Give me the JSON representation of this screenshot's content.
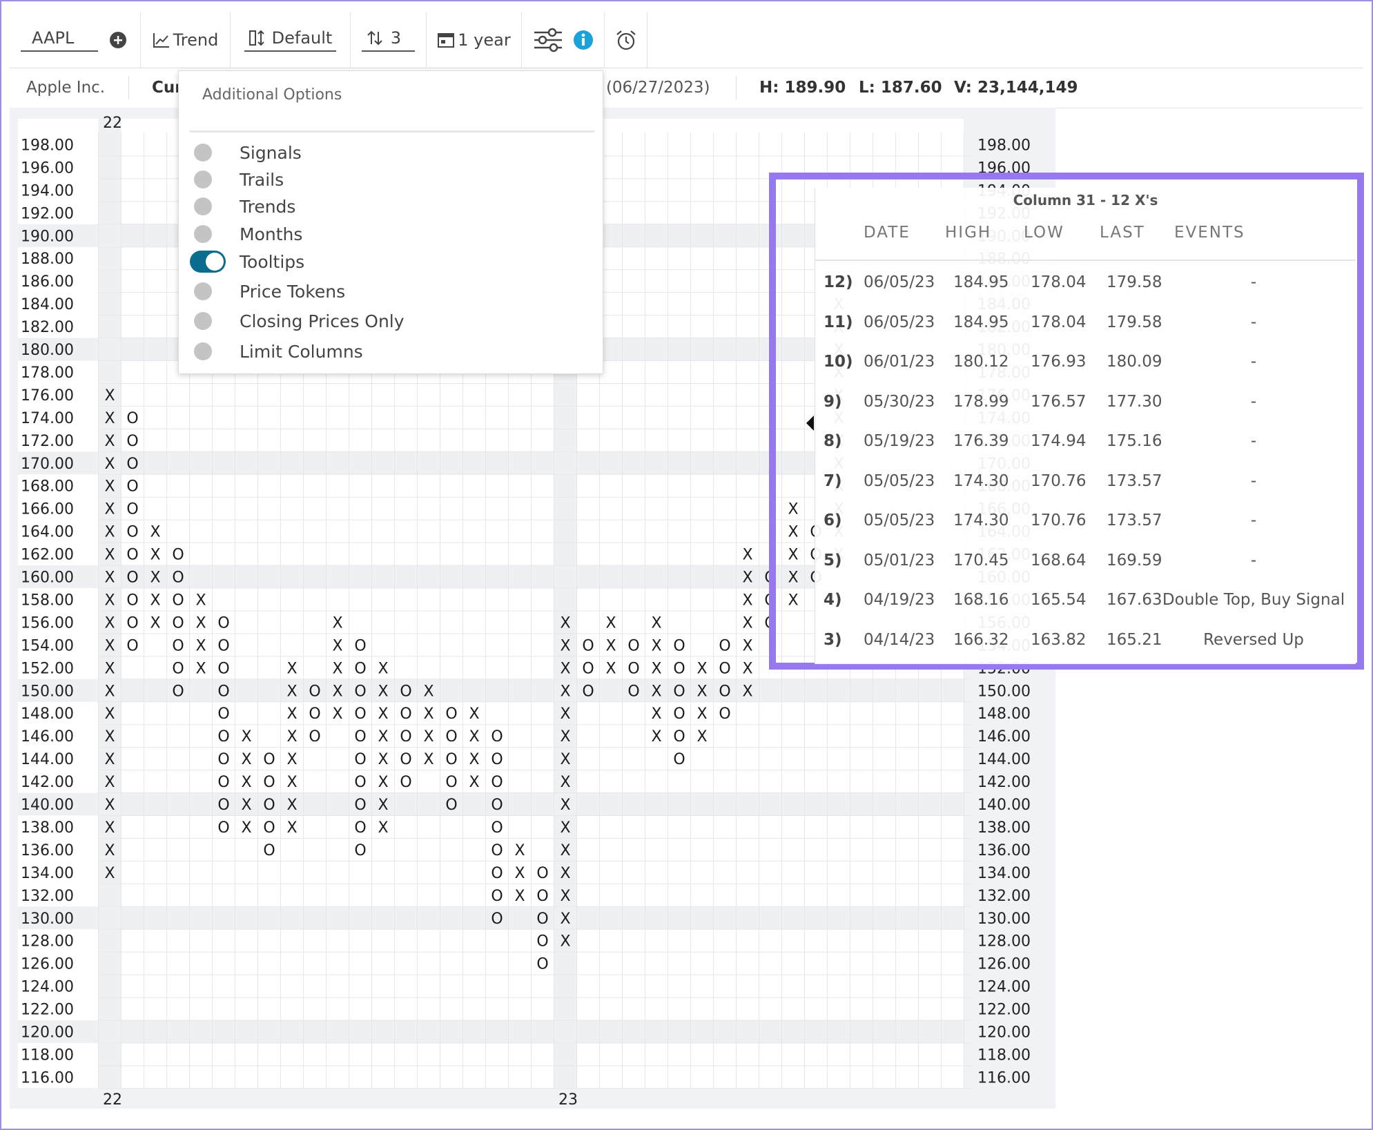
{
  "toolbar": {
    "symbol": "AAPL",
    "trend_label": "Trend",
    "default_label": "Default",
    "box_label": "3",
    "period_label": "1 year"
  },
  "infobar": {
    "company": "Apple Inc.",
    "current_partial": "Cur",
    "date_partial": "5 (06/27/2023)",
    "high": "H: 189.90",
    "low": "L: 187.60",
    "volume": "V: 23,144,149"
  },
  "dropdown": {
    "title": "Additional Options",
    "options": [
      {
        "label": "Signals",
        "on": false
      },
      {
        "label": "Trails",
        "on": false
      },
      {
        "label": "Trends",
        "on": false
      },
      {
        "label": "Months",
        "on": false
      },
      {
        "label": "Tooltips",
        "on": true
      },
      {
        "label": "Price Tokens",
        "on": false
      },
      {
        "label": "Closing Prices Only",
        "on": false
      },
      {
        "label": "Limit Columns",
        "on": false
      }
    ]
  },
  "tooltip": {
    "title": "Column 31 - 12 X's",
    "headers": [
      "DATE",
      "HIGH",
      "LOW",
      "LAST",
      "EVENTS"
    ],
    "rows": [
      {
        "n": "12)",
        "date": "06/05/23",
        "high": "184.95",
        "low": "178.04",
        "last": "179.58",
        "events": "-"
      },
      {
        "n": "11)",
        "date": "06/05/23",
        "high": "184.95",
        "low": "178.04",
        "last": "179.58",
        "events": "-"
      },
      {
        "n": "10)",
        "date": "06/01/23",
        "high": "180.12",
        "low": "176.93",
        "last": "180.09",
        "events": "-"
      },
      {
        "n": "9)",
        "date": "05/30/23",
        "high": "178.99",
        "low": "176.57",
        "last": "177.30",
        "events": "-"
      },
      {
        "n": "8)",
        "date": "05/19/23",
        "high": "176.39",
        "low": "174.94",
        "last": "175.16",
        "events": "-"
      },
      {
        "n": "7)",
        "date": "05/05/23",
        "high": "174.30",
        "low": "170.76",
        "last": "173.57",
        "events": "-"
      },
      {
        "n": "6)",
        "date": "05/05/23",
        "high": "174.30",
        "low": "170.76",
        "last": "173.57",
        "events": "-"
      },
      {
        "n": "5)",
        "date": "05/01/23",
        "high": "170.45",
        "low": "168.64",
        "last": "169.59",
        "events": "-"
      },
      {
        "n": "4)",
        "date": "04/19/23",
        "high": "168.16",
        "low": "165.54",
        "last": "167.63",
        "events": "Double Top, Buy Signal"
      },
      {
        "n": "3)",
        "date": "04/14/23",
        "high": "166.32",
        "low": "163.82",
        "last": "165.21",
        "events": "Reversed Up"
      }
    ]
  },
  "colors": {
    "accent": "#0a6c8f",
    "info": "#1aa3d9",
    "highlight_frame": "#9779ee"
  },
  "chart_data": {
    "type": "point-and-figure",
    "box_size": 2,
    "price_levels": [
      198,
      196,
      194,
      192,
      190,
      188,
      186,
      184,
      182,
      180,
      178,
      176,
      174,
      172,
      170,
      168,
      166,
      164,
      162,
      160,
      158,
      156,
      154,
      152,
      150,
      148,
      146,
      144,
      142,
      140,
      138,
      136,
      134,
      132,
      130,
      128,
      126,
      124,
      122,
      120,
      118,
      116
    ],
    "price_labels": [
      "198.00",
      "196.00",
      "194.00",
      "192.00",
      "190.00",
      "188.00",
      "186.00",
      "184.00",
      "182.00",
      "180.00",
      "178.00",
      "176.00",
      "174.00",
      "172.00",
      "170.00",
      "168.00",
      "166.00",
      "164.00",
      "162.00",
      "160.00",
      "158.00",
      "156.00",
      "154.00",
      "152.00",
      "150.00",
      "148.00",
      "146.00",
      "144.00",
      "142.00",
      "140.00",
      "138.00",
      "136.00",
      "134.00",
      "132.00",
      "130.00",
      "128.00",
      "126.00",
      "124.00",
      "122.00",
      "120.00",
      "118.00",
      "116.00"
    ],
    "year_markers": [
      {
        "label": "22",
        "col": 0
      },
      {
        "label": "23",
        "col": 20
      }
    ],
    "columns": [
      {
        "type": "X",
        "low": 134,
        "high": 176
      },
      {
        "type": "O",
        "low": 154,
        "high": 174
      },
      {
        "type": "X",
        "low": 156,
        "high": 164
      },
      {
        "type": "O",
        "low": 150,
        "high": 162
      },
      {
        "type": "X",
        "low": 152,
        "high": 158
      },
      {
        "type": "O",
        "low": 138,
        "high": 156
      },
      {
        "type": "X",
        "low": 138,
        "high": 146
      },
      {
        "type": "O",
        "low": 136,
        "high": 144
      },
      {
        "type": "X",
        "low": 138,
        "high": 152
      },
      {
        "type": "O",
        "low": 146,
        "high": 150
      },
      {
        "type": "X",
        "low": 148,
        "high": 156
      },
      {
        "type": "O",
        "low": 136,
        "high": 154
      },
      {
        "type": "X",
        "low": 138,
        "high": 152
      },
      {
        "type": "O",
        "low": 142,
        "high": 150
      },
      {
        "type": "X",
        "low": 144,
        "high": 150
      },
      {
        "type": "O",
        "low": 140,
        "high": 148
      },
      {
        "type": "X",
        "low": 142,
        "high": 148
      },
      {
        "type": "O",
        "low": 130,
        "high": 146
      },
      {
        "type": "X",
        "low": 132,
        "high": 136
      },
      {
        "type": "O",
        "low": 126,
        "high": 134
      },
      {
        "type": "X",
        "low": 128,
        "high": 156
      },
      {
        "type": "O",
        "low": 150,
        "high": 154
      },
      {
        "type": "X",
        "low": 152,
        "high": 156
      },
      {
        "type": "O",
        "low": 150,
        "high": 154
      },
      {
        "type": "X",
        "low": 146,
        "high": 156
      },
      {
        "type": "O",
        "low": 144,
        "high": 154
      },
      {
        "type": "X",
        "low": 146,
        "high": 152
      },
      {
        "type": "O",
        "low": 148,
        "high": 154
      },
      {
        "type": "X",
        "low": 150,
        "high": 162
      },
      {
        "type": "O",
        "low": 156,
        "high": 160
      },
      {
        "type": "X",
        "low": 158,
        "high": 166
      },
      {
        "type": "O",
        "low": 160,
        "high": 164
      },
      {
        "type": "X",
        "low": 162,
        "high": 184
      }
    ]
  }
}
